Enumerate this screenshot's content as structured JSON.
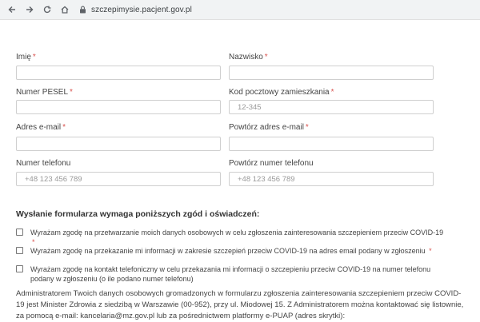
{
  "browser": {
    "url": "szczepimysie.pacjent.gov.pl",
    "icons": [
      "back-arrow-icon",
      "forward-arrow-icon",
      "reload-icon",
      "home-icon",
      "lock-icon"
    ]
  },
  "form": {
    "fields": [
      {
        "label": "Imię",
        "required": true,
        "placeholder": "",
        "value": ""
      },
      {
        "label": "Nazwisko",
        "required": true,
        "placeholder": "",
        "value": ""
      },
      {
        "label": "Numer PESEL",
        "required": true,
        "placeholder": "",
        "value": ""
      },
      {
        "label": "Kod pocztowy zamieszkania",
        "required": true,
        "placeholder": "12-345",
        "value": ""
      },
      {
        "label": "Adres e-mail",
        "required": true,
        "placeholder": "",
        "value": ""
      },
      {
        "label": "Powtórz adres e-mail",
        "required": true,
        "placeholder": "",
        "value": ""
      },
      {
        "label": "Numer telefonu",
        "required": false,
        "placeholder": "+48 123 456 789",
        "value": ""
      },
      {
        "label": "Powtórz numer telefonu",
        "required": false,
        "placeholder": "+48 123 456 789",
        "value": ""
      }
    ],
    "required_mark": "*"
  },
  "consents": {
    "title": "Wysłanie formularza wymaga poniższych zgód i oświadczeń:",
    "items": [
      {
        "text": "Wyrażam zgodę na przetwarzanie moich danych osobowych w celu zgłoszenia zainteresowania szczepieniem przeciw COVID-19",
        "required": true
      },
      {
        "text": "Wyrażam zgodę na przekazanie mi informacji w zakresie szczepień przeciw COVID-19 na adres email podany w zgłoszeniu",
        "required": true
      },
      {
        "text": "Wyrażam zgodę na kontakt telefoniczny w celu przekazania mi informacji o szczepieniu przeciw COVID-19 na numer telefonu podany w zgłoszeniu (o ile podano numer telefonu)",
        "required": false
      }
    ]
  },
  "admin_info": "Administratorem Twoich danych osobowych gromadzonych w formularzu zgłoszenia zainteresowania szczepieniem przeciw COVID-19 jest Minister Zdrowia z siedzibą w Warszawie (00-952), przy ul. Miodowej 15. Z Administratorem można kontaktować się listownie, za pomocą e-mail: kancelaria@mz.gov.pl lub za pośrednictwem platformy e-PUAP (adres skrytki):"
}
